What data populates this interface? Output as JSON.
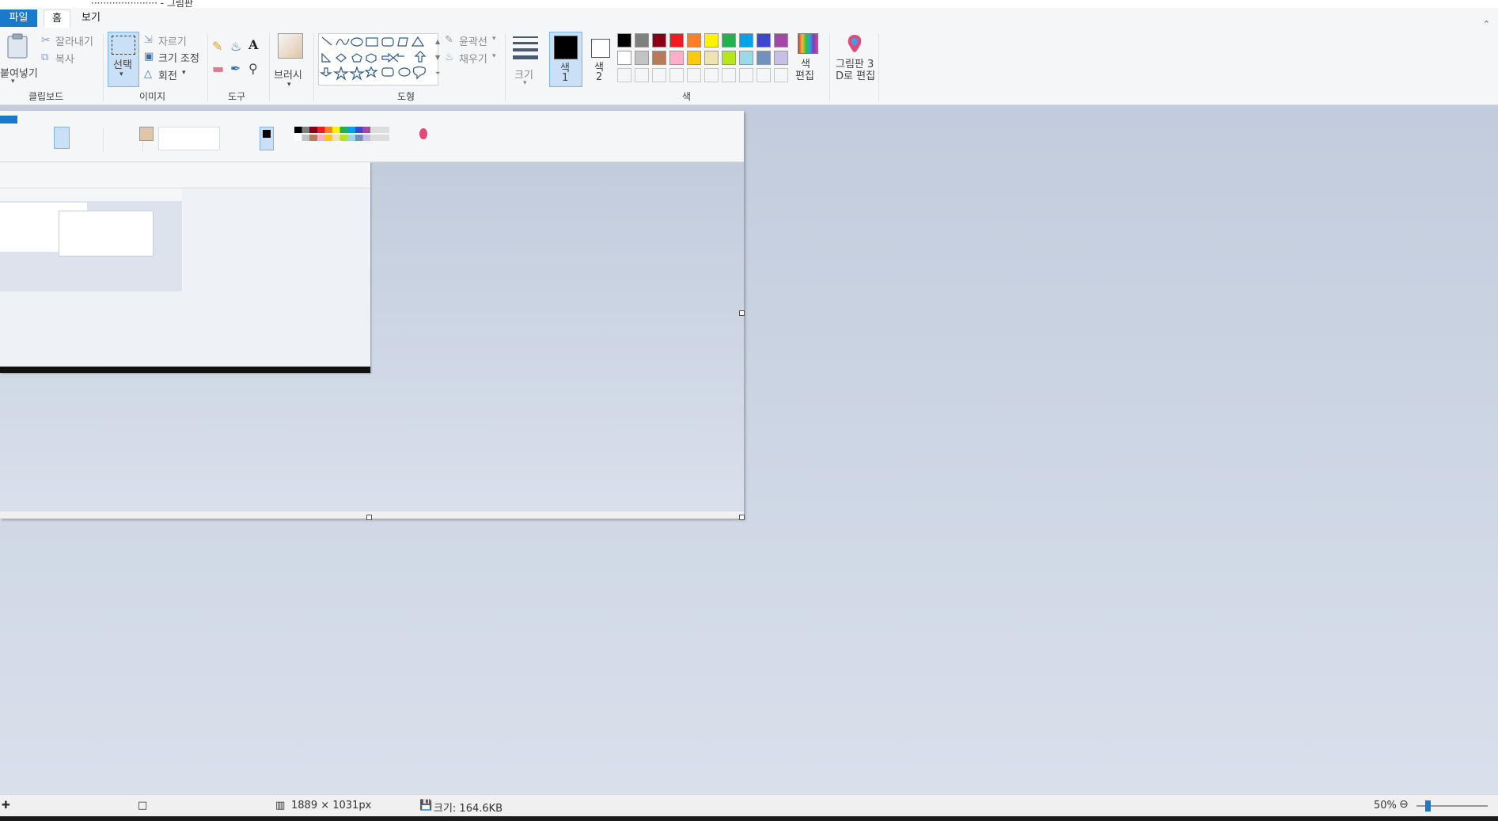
{
  "window": {
    "title": "······················ - 그림판"
  },
  "menu": {
    "file": "파일",
    "home": "홈",
    "view": "보기"
  },
  "ribbon": {
    "clipboard": {
      "paste": "붙여넣기",
      "cut": "잘라내기",
      "copy": "복사",
      "label": "클립보드"
    },
    "image": {
      "select": "선택",
      "crop": "자르기",
      "resize": "크기 조정",
      "rotate": "회전",
      "label": "이미지"
    },
    "tools": {
      "label": "도구"
    },
    "brushes": {
      "label": "브러시"
    },
    "shapes": {
      "outline": "윤곽선",
      "fill": "채우기",
      "label": "도형"
    },
    "size": {
      "label": "크기"
    },
    "colors": {
      "color1_label": "색",
      "color1_num": "1",
      "color2_label": "색",
      "color2_num": "2",
      "edit_line1": "색",
      "edit_line2": "편집",
      "label": "색",
      "color1": "#000000",
      "color2": "#ffffff",
      "row1": [
        "#000000",
        "#7f7f7f",
        "#880015",
        "#ed1c24",
        "#ff7f27",
        "#fff200",
        "#22b14c",
        "#00a2e8",
        "#3f48cc",
        "#a349a4"
      ],
      "row2": [
        "#ffffff",
        "#c3c3c3",
        "#b97a57",
        "#ffaec9",
        "#ffc90e",
        "#efe4b0",
        "#b5e61d",
        "#99d9ea",
        "#7092be",
        "#c8bfe7"
      ]
    },
    "paint3d": {
      "line1": "그림판 3",
      "line2": "D로 편집"
    }
  },
  "statusbar": {
    "dimensions": "1889 × 1031px",
    "size": "크기: 164.6KB",
    "zoom": "50%",
    "zoom_level": 0.5
  }
}
